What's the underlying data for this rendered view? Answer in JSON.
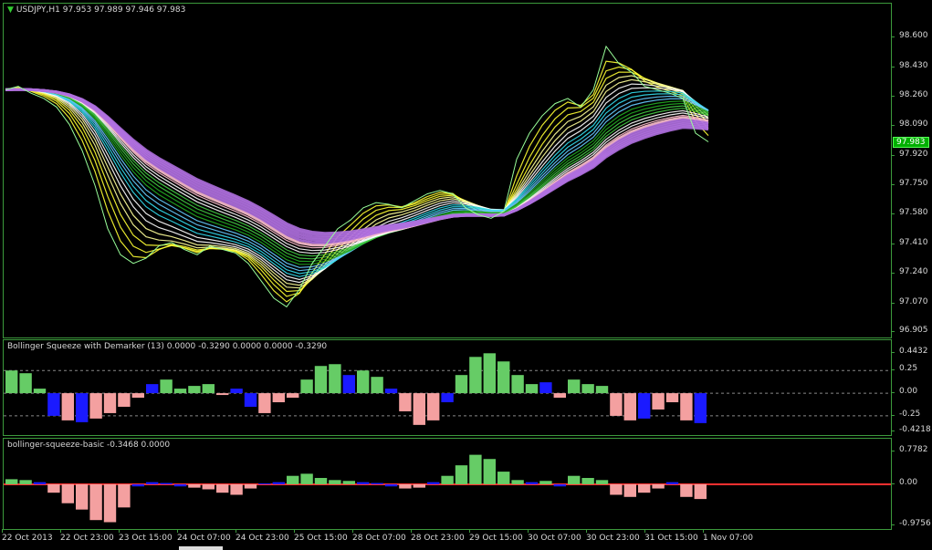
{
  "colors": {
    "bg": "#000000",
    "grid": "#3c9a3c",
    "text": "#d8d8d8",
    "bull": "#66cc66",
    "bear": "#f4a0a0",
    "blue": "#1a1aff",
    "zeroRed": "#ff3030",
    "yellow": "#ffff33",
    "violet": "#b070e0",
    "cyan": "#33ddee",
    "green": "#22aa22",
    "pink": "#ffc0d0"
  },
  "main": {
    "symbol_icon": "triangle-down-icon",
    "header": "USDJPY,H1  97.953 97.989 97.946 97.983",
    "current_price": "97.983",
    "price_ticks": [
      "98.600",
      "98.430",
      "98.260",
      "98.090",
      "97.920",
      "97.750",
      "97.580",
      "97.410",
      "97.240",
      "97.070",
      "96.905"
    ]
  },
  "indicator1": {
    "header": "Bollinger Squeeze with Demarker (13) 0.0000 -0.3290 0.0000 0.0000 -0.3290",
    "ticks": [
      "0.4432",
      "0.25",
      "0.00",
      "-0.25",
      "-0.4218"
    ]
  },
  "indicator2": {
    "header": "bollinger-squeeze-basic -0.3468 0.0000",
    "ticks": [
      "0.7782",
      "0.00",
      "-0.9756"
    ]
  },
  "time_axis": [
    "22 Oct 2013",
    "22 Oct 23:00",
    "23 Oct 15:00",
    "24 Oct 07:00",
    "24 Oct 23:00",
    "25 Oct 15:00",
    "28 Oct 07:00",
    "28 Oct 23:00",
    "29 Oct 15:00",
    "30 Oct 07:00",
    "30 Oct 23:00",
    "31 Oct 15:00",
    "1 Nov 07:00"
  ],
  "chart_data": [
    {
      "type": "line",
      "title": "USDJPY,H1",
      "ylim": [
        96.905,
        98.68
      ],
      "series": [
        {
          "values": [
            98.3,
            98.32,
            98.28,
            98.25,
            98.2,
            98.1,
            97.95,
            97.75,
            97.5,
            97.35,
            97.3,
            97.33,
            97.4,
            97.42,
            97.38,
            97.35,
            97.4,
            97.38,
            97.36,
            97.3,
            97.2,
            97.1,
            97.05,
            97.15,
            97.3,
            97.4,
            97.5,
            97.55,
            97.62,
            97.65,
            97.64,
            97.62,
            97.66,
            97.7,
            97.72,
            97.7,
            97.62,
            97.58,
            97.56,
            97.6,
            97.9,
            98.05,
            98.15,
            98.22,
            98.25,
            98.2,
            98.3,
            98.55,
            98.45,
            98.4,
            98.32,
            98.3,
            98.28,
            98.25,
            98.05,
            98.0
          ]
        }
      ]
    },
    {
      "type": "bar",
      "title": "Bollinger Squeeze with Demarker (13)",
      "ylim": [
        -0.4218,
        0.4432
      ],
      "values": [
        0.25,
        0.22,
        0.05,
        -0.25,
        -0.3,
        -0.32,
        -0.28,
        -0.22,
        -0.15,
        -0.05,
        0.1,
        0.15,
        0.05,
        0.08,
        0.1,
        -0.02,
        0.05,
        -0.15,
        -0.22,
        -0.1,
        -0.05,
        0.15,
        0.3,
        0.32,
        0.2,
        0.25,
        0.18,
        0.05,
        -0.2,
        -0.35,
        -0.3,
        -0.1,
        0.2,
        0.4,
        0.44,
        0.35,
        0.2,
        0.1,
        0.12,
        -0.05,
        0.15,
        0.1,
        0.08,
        -0.25,
        -0.3,
        -0.28,
        -0.18,
        -0.1,
        -0.3,
        -0.33
      ]
    },
    {
      "type": "bar",
      "title": "bollinger-squeeze-basic",
      "ylim": [
        -0.9756,
        0.7782
      ],
      "values": [
        0.12,
        0.1,
        0.05,
        -0.2,
        -0.45,
        -0.6,
        -0.85,
        -0.9,
        -0.55,
        -0.05,
        0.05,
        0.03,
        -0.05,
        -0.08,
        -0.12,
        -0.2,
        -0.25,
        -0.1,
        0.02,
        0.05,
        0.2,
        0.25,
        0.15,
        0.1,
        0.08,
        0.05,
        0.03,
        -0.05,
        -0.1,
        -0.08,
        0.05,
        0.2,
        0.45,
        0.7,
        0.6,
        0.3,
        0.1,
        0.05,
        0.08,
        -0.05,
        0.2,
        0.15,
        0.1,
        -0.25,
        -0.3,
        -0.2,
        -0.1,
        0.05,
        -0.3,
        -0.35
      ]
    }
  ]
}
